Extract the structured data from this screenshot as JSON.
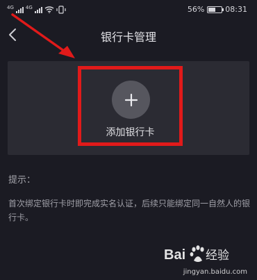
{
  "status_bar": {
    "signal_1_label": "4G",
    "signal_2_label": "4G",
    "battery_percent": "56%",
    "battery_level": 0.56,
    "time": "08:31",
    "icons": [
      "signal-icon",
      "wifi-icon",
      "vibrate-icon",
      "battery-icon"
    ]
  },
  "header": {
    "title": "银行卡管理",
    "back_icon": "chevron-left-icon"
  },
  "bank_card_section": {
    "add_button_label": "添加银行卡",
    "add_icon": "plus-icon"
  },
  "tips": {
    "title": "提示：",
    "text": "首次绑定银行卡时即完成实名认证，后续只能绑定同一自然人的银行卡。"
  },
  "watermark": {
    "brand": "Baidu 经验",
    "url": "jingyan.baidu.com"
  },
  "colors": {
    "background": "#1b1b23",
    "card": "#2b2b33",
    "annotation_red": "#e11a1a"
  }
}
